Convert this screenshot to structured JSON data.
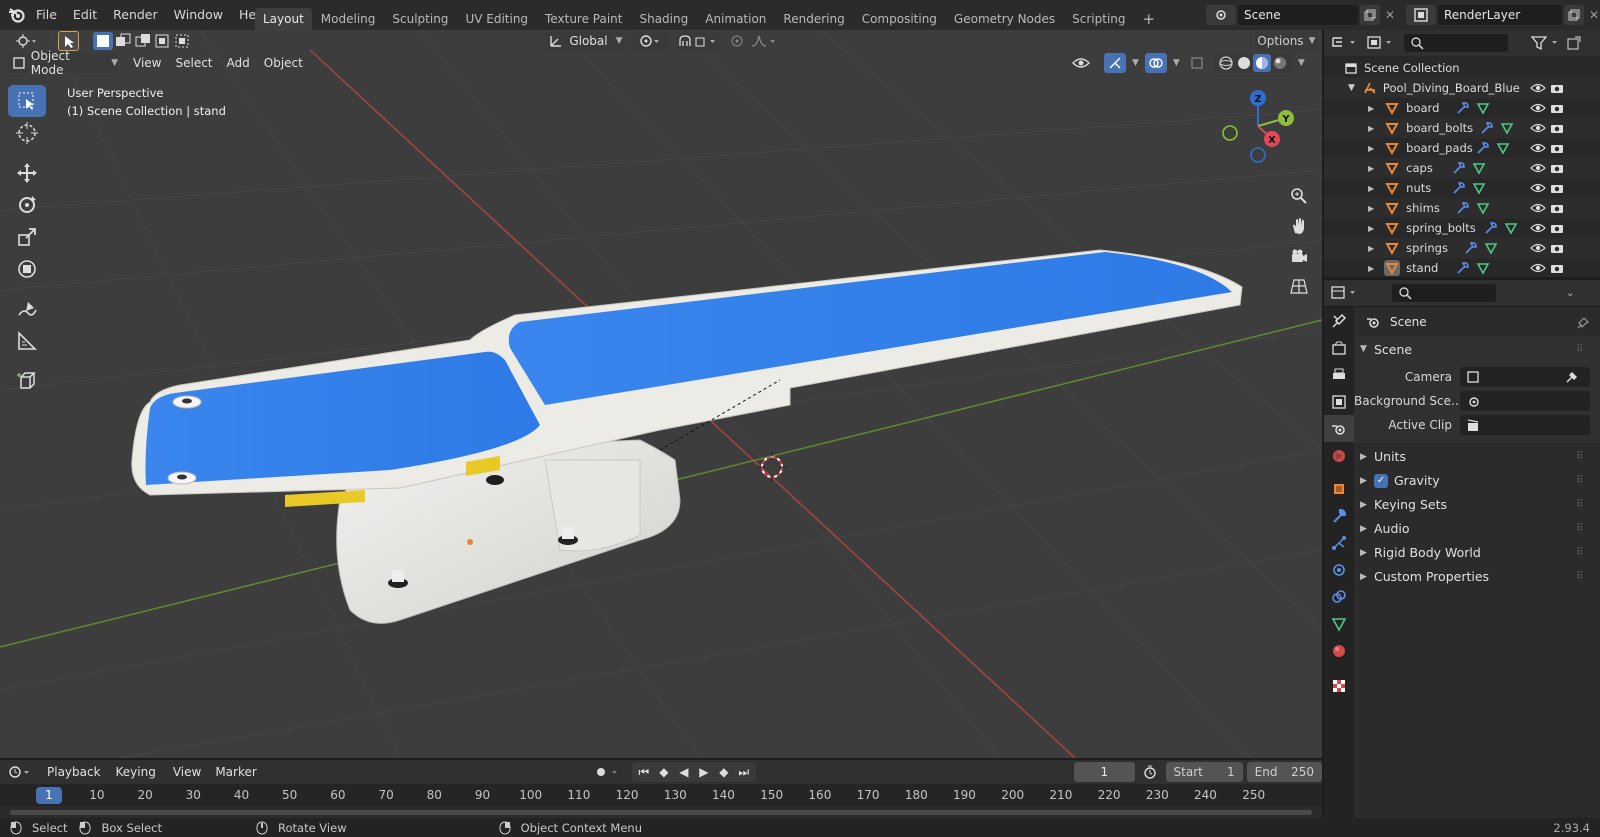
{
  "topbar": {
    "menus": [
      "File",
      "Edit",
      "Render",
      "Window",
      "Help"
    ],
    "workspaces": [
      "Layout",
      "Modeling",
      "Sculpting",
      "UV Editing",
      "Texture Paint",
      "Shading",
      "Animation",
      "Rendering",
      "Compositing",
      "Geometry Nodes",
      "Scripting"
    ],
    "active_workspace": "Layout",
    "scene": "Scene",
    "view_layer": "RenderLayer"
  },
  "tool_header": {
    "transform_orientation": "Global",
    "options_label": "Options"
  },
  "viewport_header": {
    "mode": "Object Mode",
    "menus": [
      "View",
      "Select",
      "Add",
      "Object"
    ]
  },
  "viewport": {
    "perspective_label": "User Perspective",
    "collection_label": "(1) Scene Collection | stand",
    "gizmo_axes": [
      "Z",
      "Y",
      "X"
    ],
    "colors": {
      "board_blue": "#2f7fe8",
      "x_axis": "#c24a4a",
      "y_axis": "#6a9a30",
      "background": "#3d3d3d"
    }
  },
  "outliner": {
    "root": "Scene Collection",
    "collection": "Pool_Diving_Board_Blue",
    "items": [
      "board",
      "board_bolts",
      "board_pads",
      "caps",
      "nuts",
      "shims",
      "spring_bolts",
      "springs",
      "stand"
    ],
    "selected_item": "stand"
  },
  "properties": {
    "context": "Scene",
    "panel_title": "Scene",
    "fields": [
      {
        "label": "Camera",
        "value": ""
      },
      {
        "label": "Background Sce...",
        "value": ""
      },
      {
        "label": "Active Clip",
        "value": ""
      }
    ],
    "subpanels": [
      "Units",
      "Gravity",
      "Keying Sets",
      "Audio",
      "Rigid Body World",
      "Custom Properties"
    ],
    "gravity_checked": true
  },
  "timeline": {
    "menus": [
      "Playback",
      "Keying",
      "View",
      "Marker"
    ],
    "current_frame": "1",
    "start_label": "Start",
    "start": "1",
    "end_label": "End",
    "end": "250",
    "ticks": [
      "1",
      "10",
      "20",
      "30",
      "40",
      "50",
      "60",
      "70",
      "80",
      "90",
      "100",
      "110",
      "120",
      "130",
      "140",
      "150",
      "160",
      "170",
      "180",
      "190",
      "200",
      "210",
      "220",
      "230",
      "240",
      "250"
    ]
  },
  "statusbar": {
    "select": "Select",
    "box_select": "Box Select",
    "rotate_view": "Rotate View",
    "context_menu": "Object Context Menu",
    "version": "2.93.4"
  }
}
